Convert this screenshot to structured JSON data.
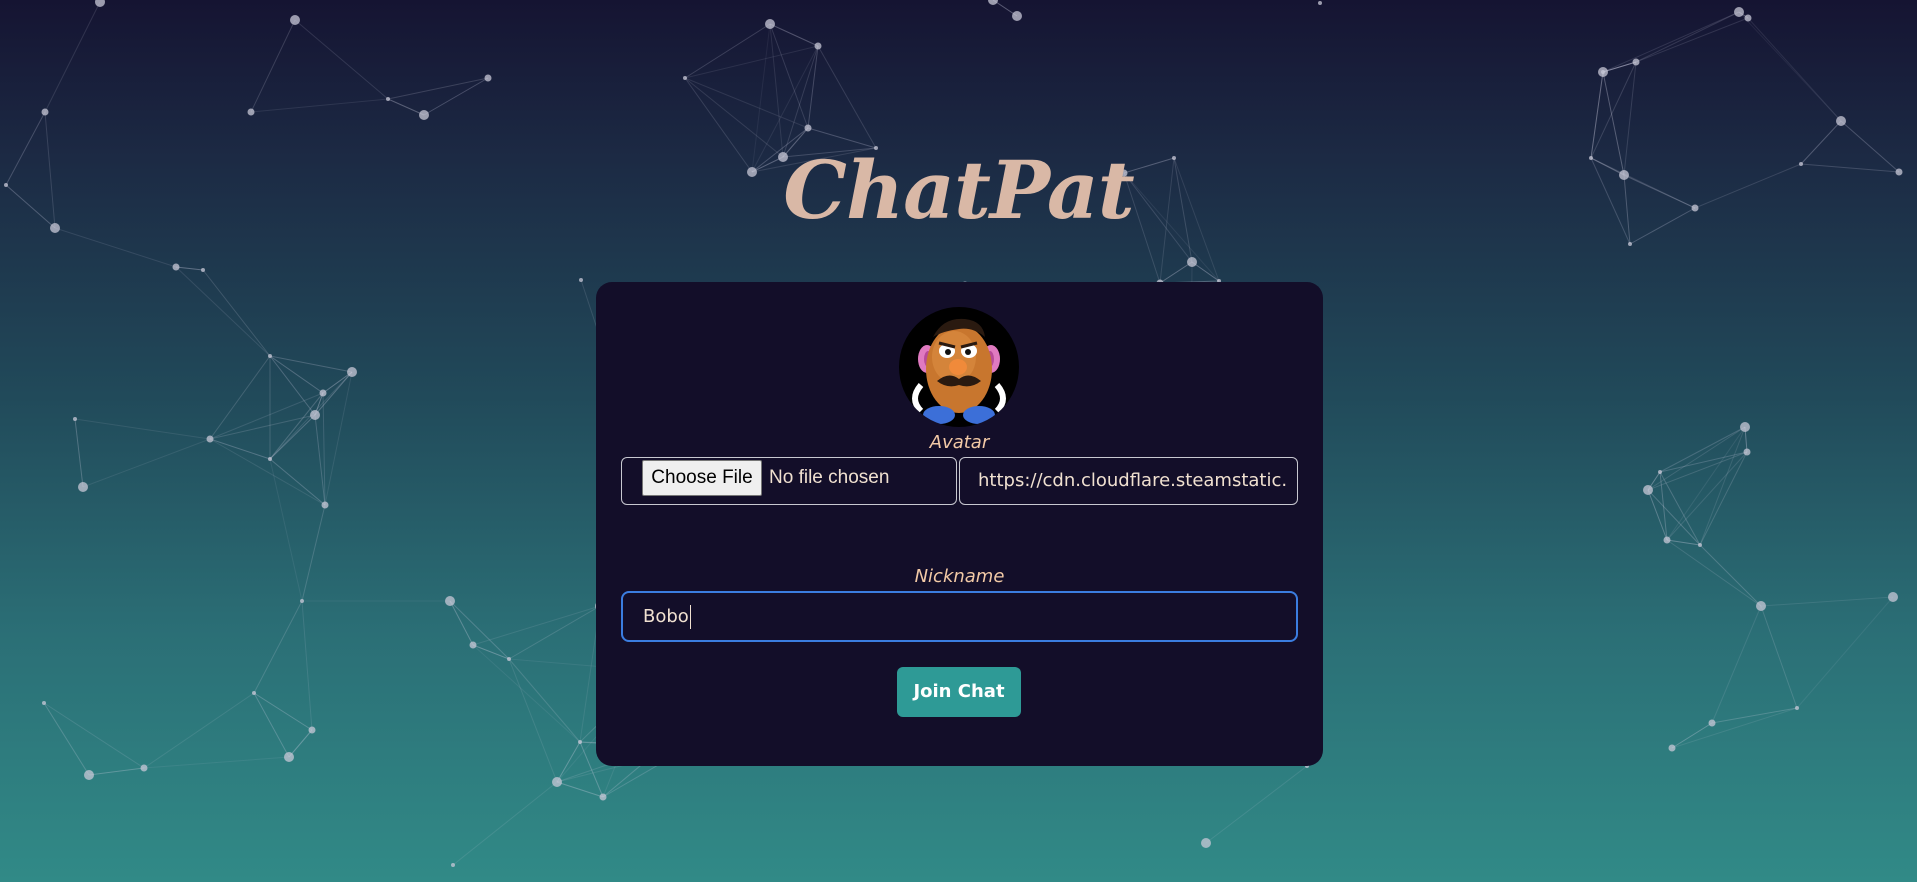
{
  "app": {
    "title": "ChatPat"
  },
  "form": {
    "avatar_label": "Avatar",
    "avatar_image": "mr-potato-head",
    "file_button_label": "Choose File",
    "file_status": "No file chosen",
    "avatar_url_value": "https://cdn.cloudflare.steamstatic.",
    "nickname_label": "Nickname",
    "nickname_value": "Bobo",
    "submit_label": "Join Chat"
  },
  "colors": {
    "title": "#d9b8a6",
    "card_background": "#130e29",
    "label": "#f2c9a6",
    "focus_border": "#3b7de0",
    "button": "#2e9a96"
  }
}
